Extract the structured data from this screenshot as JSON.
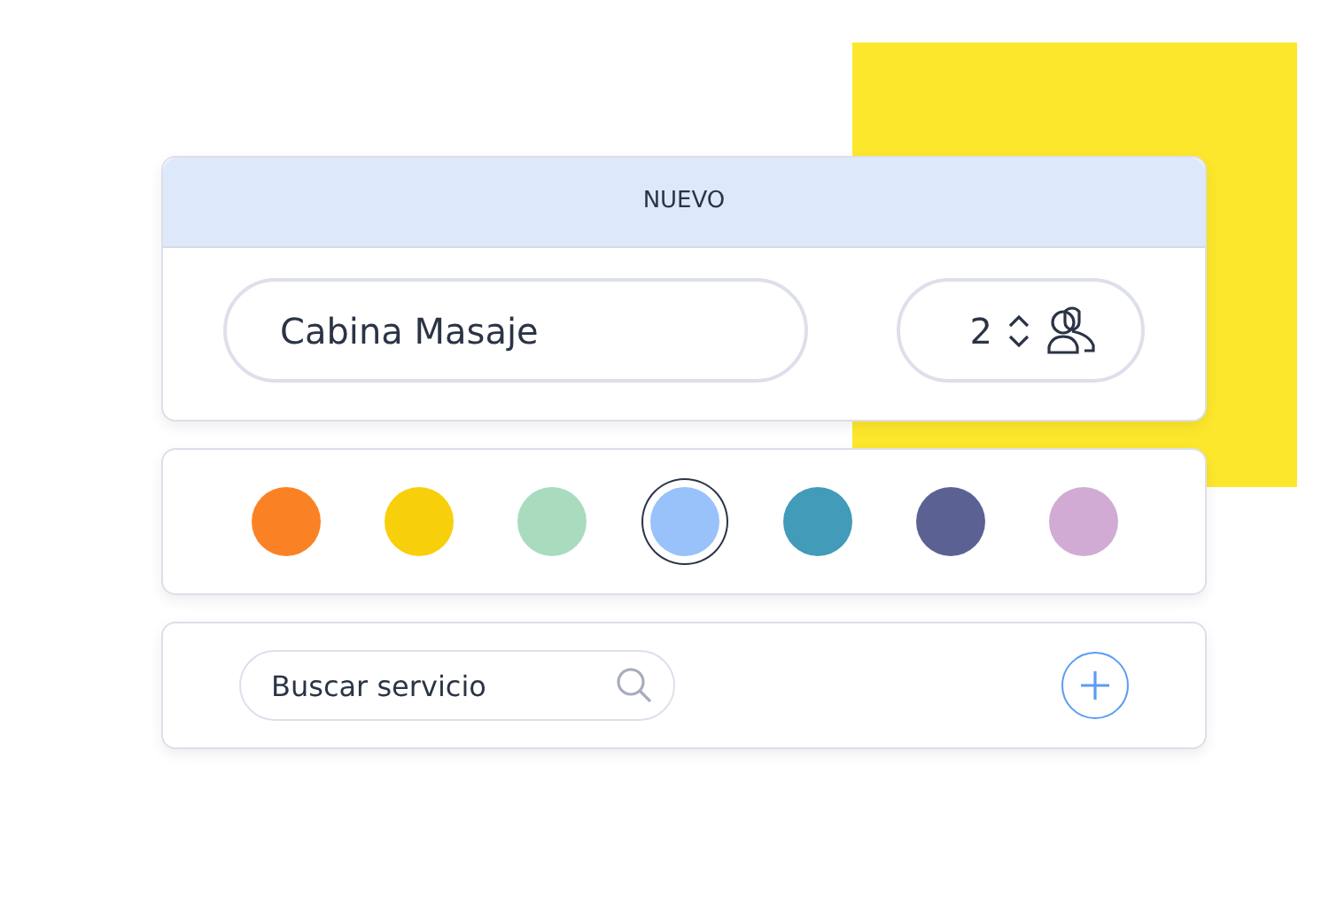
{
  "card_header": {
    "title": "NUEVO"
  },
  "name_field": {
    "value": "Cabina Masaje"
  },
  "capacity": {
    "value": "2"
  },
  "colors": [
    {
      "color": "#fa8225",
      "selected": false
    },
    {
      "color": "#f7cf0b",
      "selected": false
    },
    {
      "color": "#a9dbbf",
      "selected": false
    },
    {
      "color": "#99c2fb",
      "selected": true
    },
    {
      "color": "#429bb8",
      "selected": false
    },
    {
      "color": "#5b6293",
      "selected": false
    },
    {
      "color": "#d1abd3",
      "selected": false
    }
  ],
  "search": {
    "placeholder": "Buscar servicio"
  }
}
